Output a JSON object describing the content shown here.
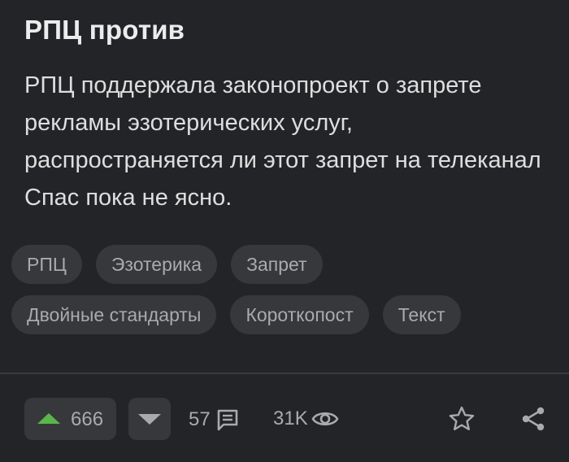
{
  "post": {
    "title": "РПЦ против",
    "body": "РПЦ поддержала законопроект о запрете рекламы эзотерических услуг, распространяется ли этот запрет на телеканал Спас пока не ясно."
  },
  "tags": {
    "row1": [
      "РПЦ",
      "Эзотерика",
      "Запрет"
    ],
    "row2": [
      "Двойные стандарты",
      "Короткопост",
      "Текст"
    ]
  },
  "actions": {
    "rating": "666",
    "comments": "57",
    "views": "31K"
  },
  "icons": {
    "upvote": "arrow-up-icon",
    "downvote": "arrow-down-icon",
    "comments": "comment-icon",
    "views": "eye-icon",
    "save": "star-icon",
    "share": "share-icon"
  },
  "colors": {
    "background": "#232428",
    "tag_background": "#37383c",
    "upvote_accent": "#59b64a",
    "muted_text": "#a9aaad"
  }
}
